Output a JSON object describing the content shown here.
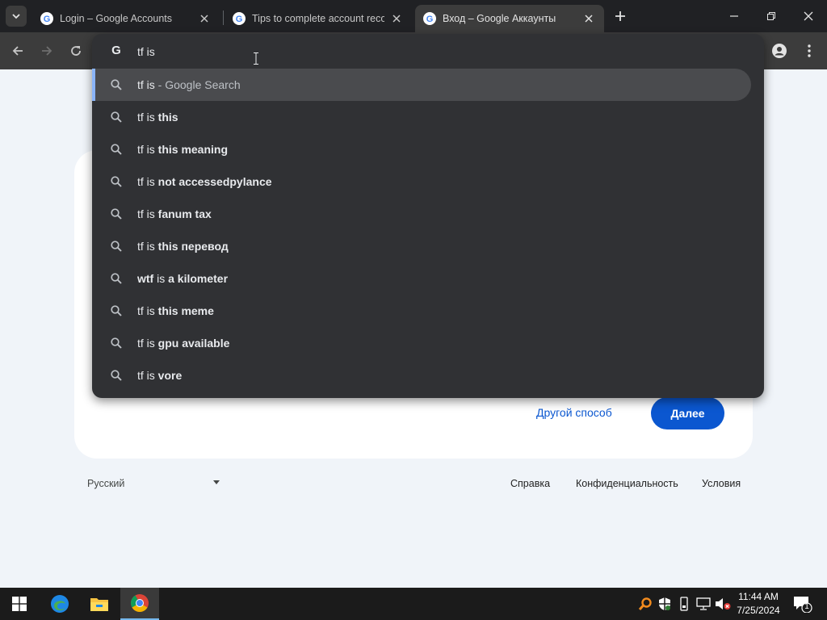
{
  "browser": {
    "tabs": [
      {
        "title": "Login – Google Accounts",
        "active": false
      },
      {
        "title": "Tips to complete account recovery",
        "active": false
      },
      {
        "title": "Вход – Google Аккаунты",
        "active": true
      }
    ],
    "colors": {
      "tabstrip": "#202124",
      "toolbar": "#3c3c3c",
      "dropdown": "#303134",
      "accent": "#8ab4f8"
    }
  },
  "omnibox": {
    "query": "tf is",
    "suggestions": [
      {
        "prefix": "tf is",
        "bold": "",
        "suffix": " - Google Search",
        "selected": true
      },
      {
        "prefix": "tf is ",
        "bold": "this",
        "suffix": "",
        "selected": false
      },
      {
        "prefix": "tf is ",
        "bold": "this meaning",
        "suffix": "",
        "selected": false
      },
      {
        "prefix": "tf is ",
        "bold": "not accessedpylance",
        "suffix": "",
        "selected": false
      },
      {
        "prefix": "tf is ",
        "bold": "fanum tax",
        "suffix": "",
        "selected": false
      },
      {
        "prefix": "tf is ",
        "bold": "this перевод",
        "suffix": "",
        "selected": false
      },
      {
        "lead_bold": "wtf",
        "prefix": " is ",
        "bold": "a kilometer",
        "suffix": "",
        "selected": false
      },
      {
        "prefix": "tf is ",
        "bold": "this meme",
        "suffix": "",
        "selected": false
      },
      {
        "prefix": "tf is ",
        "bold": "gpu available",
        "suffix": "",
        "selected": false
      },
      {
        "prefix": "tf is ",
        "bold": "vore",
        "suffix": "",
        "selected": false
      }
    ]
  },
  "page": {
    "other_way_link": "Другой способ",
    "next_button": "Далее",
    "language": "Русский",
    "footer_links": {
      "help": "Справка",
      "privacy": "Конфиденциальность",
      "terms": "Условия"
    },
    "colors": {
      "primary": "#0b57d0",
      "background": "#f0f4f9"
    }
  },
  "taskbar": {
    "time": "11:44 AM",
    "date": "7/25/2024",
    "notification_count": "1",
    "pinned": [
      "edge-icon",
      "file-explorer-icon",
      "chrome-icon"
    ]
  }
}
